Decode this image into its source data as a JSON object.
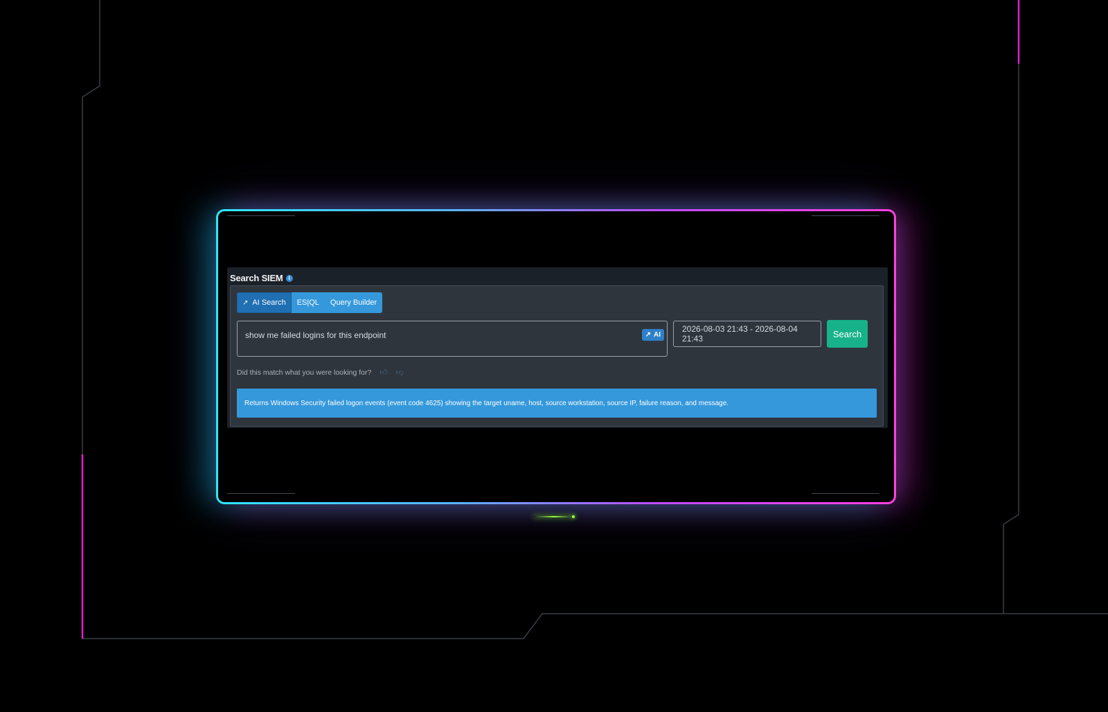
{
  "panel": {
    "title": "Search SIEM",
    "info_icon": "info-icon"
  },
  "tabs": [
    {
      "label": "AI Search",
      "icon": "wand-icon",
      "active": true
    },
    {
      "label": "ES|QL",
      "active": false
    },
    {
      "label": "Query Builder",
      "active": false
    }
  ],
  "query": {
    "value": "show me failed logins for this endpoint",
    "ai_badge": "AI"
  },
  "date_range": {
    "value": "2026-08-03 21:43 - 2026-08-04 21:43"
  },
  "search_button": "Search",
  "feedback": {
    "prompt": "Did this match what you were looking for?",
    "up_icon": "thumbs-up-icon",
    "down_icon": "thumbs-down-icon"
  },
  "result_description": "Returns Windows Security failed logon events (event code 4625) showing the target uname, host, source workstation, source IP, failure reason, and message.",
  "colors": {
    "frame_left": "#2ee8ff",
    "frame_right": "#ff3fe0",
    "accent_blue": "#3498db",
    "search_green": "#17b28a",
    "circuit_magenta": "#e020d0"
  }
}
